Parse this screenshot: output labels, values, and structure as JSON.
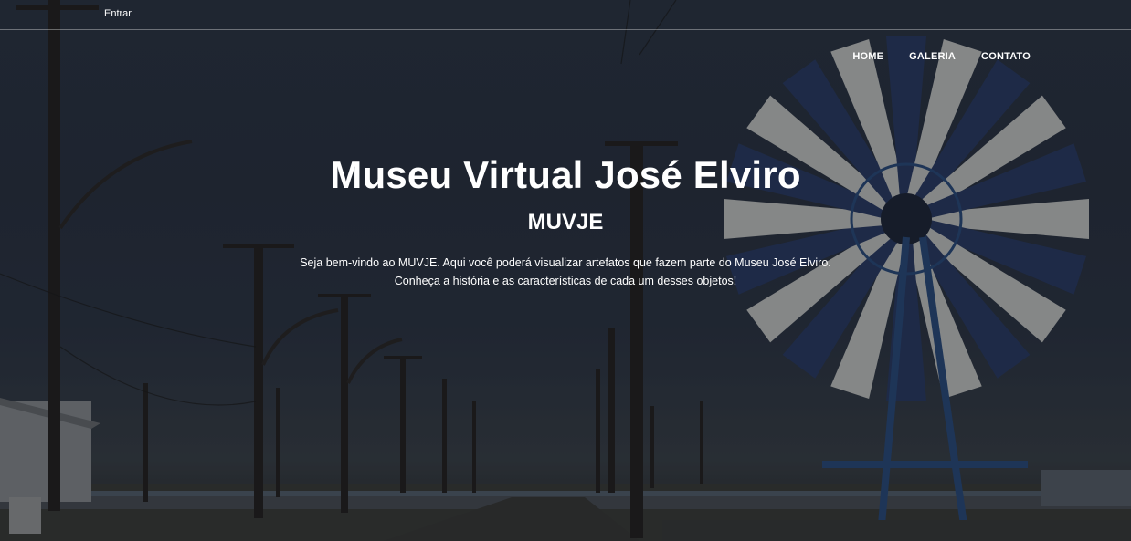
{
  "topbar": {
    "login_link": "Entrar"
  },
  "nav": {
    "items": [
      {
        "label": "HOME"
      },
      {
        "label": "GALERIA"
      },
      {
        "label": "CONTATO"
      }
    ]
  },
  "hero": {
    "title": "Museu Virtual José Elviro",
    "subtitle": "MUVJE",
    "description_line1": "Seja bem-vindo ao MUVJE. Aqui você poderá visualizar artefatos que fazem parte do Museu José Elviro.",
    "description_line2": "Conheça a história e as características de cada um desses objetos!"
  },
  "colors": {
    "text": "#ffffff",
    "sky": "#2b3340",
    "windmill_blue": "#2a4a7a"
  }
}
